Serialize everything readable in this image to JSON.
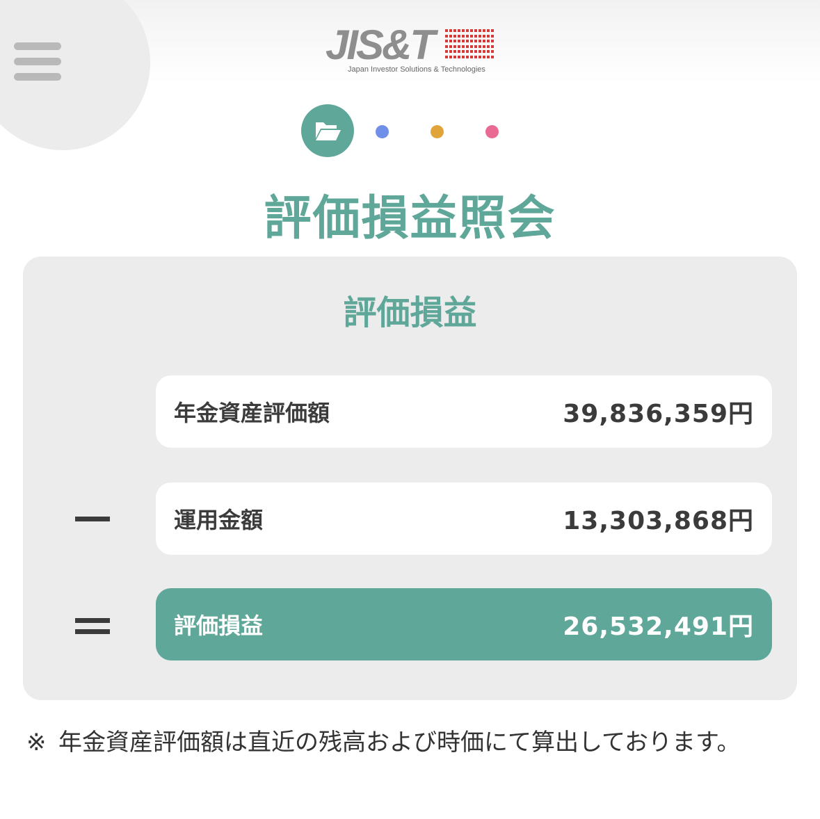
{
  "header": {
    "logo_text": "JIS&T",
    "logo_tagline": "Japan Investor Solutions & Technologies"
  },
  "steps": {
    "active_icon": "folder-open-icon",
    "dot_colors": [
      "#6f8fe8",
      "#e0a43a",
      "#e96a93"
    ]
  },
  "page": {
    "title": "評価損益照会"
  },
  "panel": {
    "title": "評価損益",
    "rows": [
      {
        "operator": "",
        "label": "年金資産評価額",
        "value": "39,836,359円"
      },
      {
        "operator": "−",
        "label": "運用金額",
        "value": "13,303,868円"
      },
      {
        "operator": "=",
        "label": "評価損益",
        "value": "26,532,491円"
      }
    ]
  },
  "note": {
    "mark": "※",
    "text": "年金資産評価額は直近の残高および時価にて算出しております。"
  },
  "colors": {
    "accent": "#5ea799",
    "panel_bg": "#ececec"
  }
}
